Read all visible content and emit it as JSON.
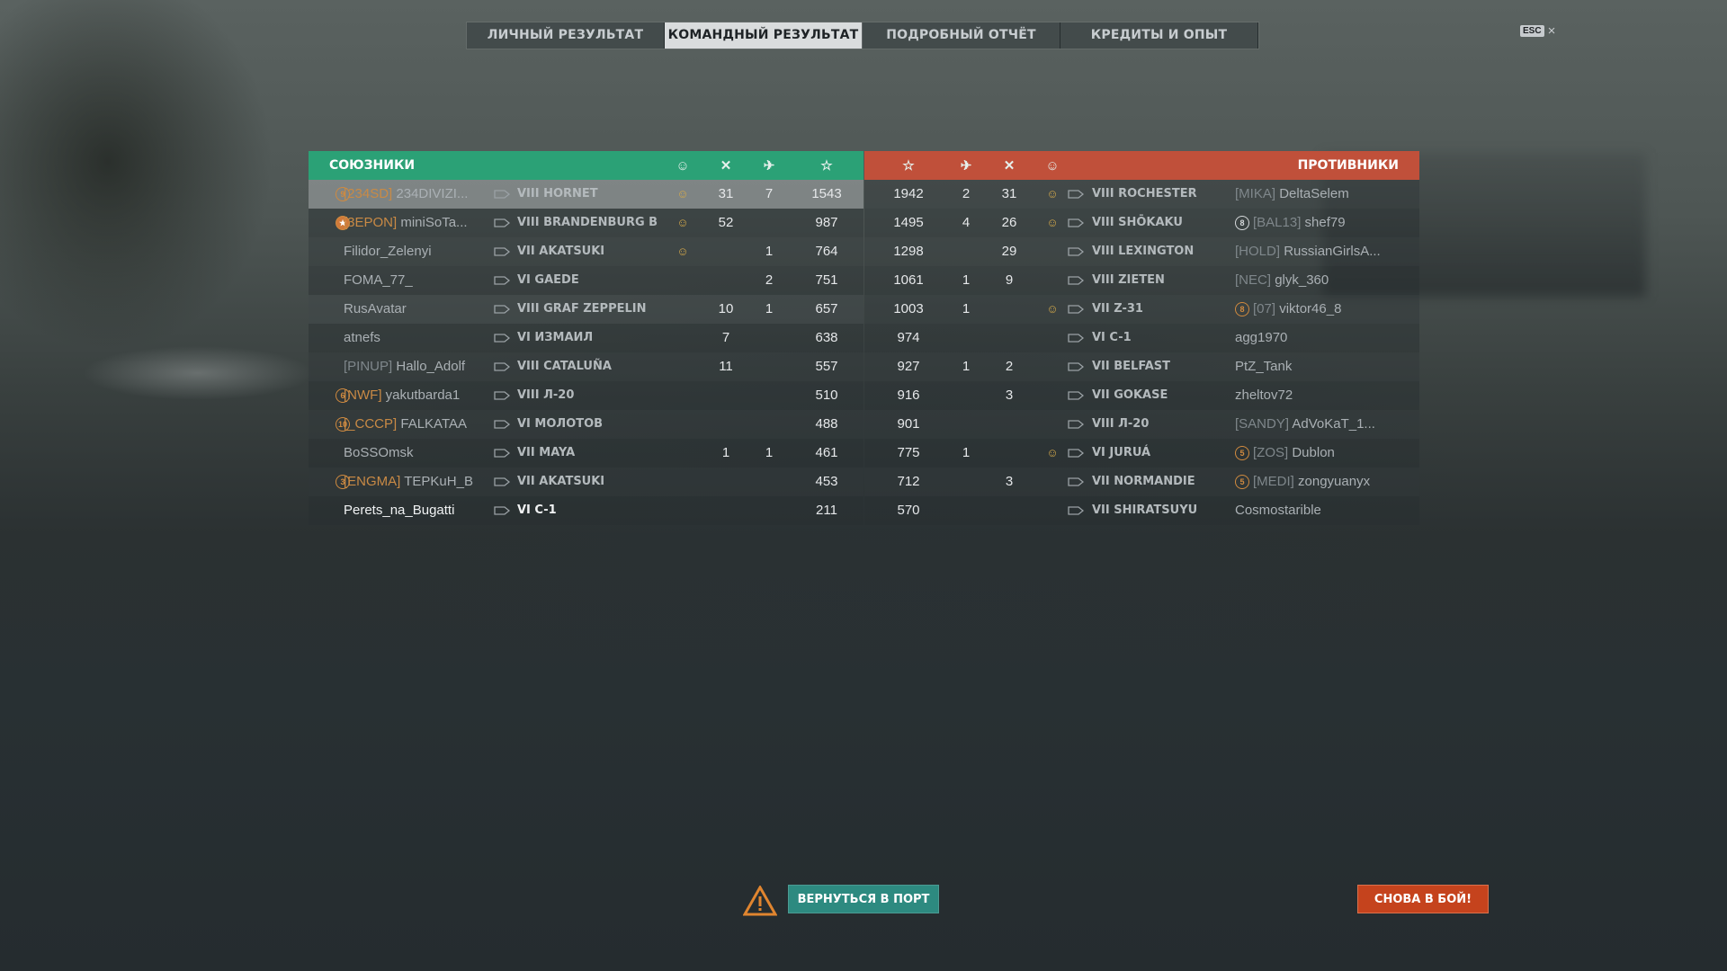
{
  "tabs": [
    "ЛИЧНЫЙ РЕЗУЛЬТАТ",
    "КОМАНДНЫЙ РЕЗУЛЬТАТ",
    "ПОДРОБНЫЙ ОТЧЁТ",
    "КРЕДИТЫ И ОПЫТ"
  ],
  "active_tab": 1,
  "esc_label": "ESC",
  "allies": {
    "title": "СОЮЗНИКИ",
    "header_icons": [
      "capture-icon",
      "kills-icon",
      "planes-icon",
      "experience-icon"
    ],
    "rows": [
      {
        "rank": "9",
        "rank_style": "orange",
        "clan": "[234SD]",
        "player": "234DIVIZI...",
        "ship": "VIII HORNET",
        "medal": true,
        "kills": "31",
        "planes": "7",
        "exp": "1543",
        "state": "highlight"
      },
      {
        "rank": "★",
        "rank_style": "star",
        "clan": "[3EPON]",
        "player": "miniSoTa...",
        "ship": "VIII BRANDENBURG B",
        "medal": true,
        "kills": "52",
        "planes": "",
        "exp": "987",
        "state": ""
      },
      {
        "rank": "",
        "rank_style": "",
        "clan": "",
        "player": "Filidor_Zelenyi",
        "ship": "VII AKATSUKI",
        "medal": true,
        "kills": "",
        "planes": "1",
        "exp": "764",
        "state": ""
      },
      {
        "rank": "",
        "rank_style": "",
        "clan": "",
        "player": "FOMA_77_",
        "ship": "VI GAEDE",
        "medal": false,
        "kills": "",
        "planes": "2",
        "exp": "751",
        "state": ""
      },
      {
        "rank": "",
        "rank_style": "",
        "clan": "",
        "player": "RusAvatar",
        "ship": "VIII GRAF ZEPPELIN",
        "medal": false,
        "kills": "10",
        "planes": "1",
        "exp": "657",
        "state": "me"
      },
      {
        "rank": "",
        "rank_style": "",
        "clan": "",
        "player": "atnefs",
        "ship": "VI ИЗМАИЛ",
        "medal": false,
        "kills": "7",
        "planes": "",
        "exp": "638",
        "state": ""
      },
      {
        "rank": "",
        "rank_style": "",
        "clan": "[PINUP]",
        "player": "Hallo_Adolf",
        "ship": "VIII CATALUÑA",
        "medal": false,
        "kills": "11",
        "planes": "",
        "exp": "557",
        "state": ""
      },
      {
        "rank": "6",
        "rank_style": "orange",
        "clan": "[NWF]",
        "player": "yakutbarda1",
        "ship": "VIII Л-20",
        "medal": false,
        "kills": "",
        "planes": "",
        "exp": "510",
        "state": ""
      },
      {
        "rank": "10",
        "rank_style": "orange",
        "clan": "[_CCCP]",
        "player": "FALKATAA",
        "ship": "VI МОЛОТОВ",
        "medal": false,
        "kills": "",
        "planes": "",
        "exp": "488",
        "state": ""
      },
      {
        "rank": "",
        "rank_style": "",
        "clan": "",
        "player": "BoSSOmsk",
        "ship": "VII MAYA",
        "medal": false,
        "kills": "1",
        "planes": "1",
        "exp": "461",
        "state": ""
      },
      {
        "rank": "3",
        "rank_style": "orange",
        "clan": "[ENGMA]",
        "player": "TEPKuH_B",
        "ship": "VII AKATSUKI",
        "medal": false,
        "kills": "",
        "planes": "",
        "exp": "453",
        "state": ""
      },
      {
        "rank": "",
        "rank_style": "",
        "clan": "",
        "player": "Perets_na_Bugatti",
        "ship": "VI C-1",
        "medal": false,
        "kills": "",
        "planes": "",
        "exp": "211",
        "state": "bright"
      }
    ]
  },
  "enemies": {
    "title": "ПРОТИВНИКИ",
    "header_icons": [
      "experience-icon",
      "planes-icon",
      "kills-icon",
      "capture-icon"
    ],
    "rows": [
      {
        "exp": "1942",
        "planes": "2",
        "kills": "31",
        "medal": true,
        "ship": "VIII ROCHESTER",
        "rank": "",
        "rank_style": "",
        "clan": "[MIKA]",
        "player": "DeltaSelem"
      },
      {
        "exp": "1495",
        "planes": "4",
        "kills": "26",
        "medal": true,
        "ship": "VIII SHŌKAKU",
        "rank": "8",
        "rank_style": "white",
        "clan": "[BAL13]",
        "player": "shef79"
      },
      {
        "exp": "1298",
        "planes": "",
        "kills": "29",
        "medal": false,
        "ship": "VIII LEXINGTON",
        "rank": "",
        "rank_style": "",
        "clan": "[HOLD]",
        "player": "RussianGirlsA..."
      },
      {
        "exp": "1061",
        "planes": "1",
        "kills": "9",
        "medal": false,
        "ship": "VIII ZIETEN",
        "rank": "",
        "rank_style": "",
        "clan": "[NEC]",
        "player": "glyk_360"
      },
      {
        "exp": "1003",
        "planes": "1",
        "kills": "",
        "medal": true,
        "ship": "VII Z-31",
        "rank": "8",
        "rank_style": "orange",
        "clan": "[07]",
        "player": "viktor46_8"
      },
      {
        "exp": "974",
        "planes": "",
        "kills": "",
        "medal": false,
        "ship": "VI C-1",
        "rank": "",
        "rank_style": "",
        "clan": "",
        "player": "agg1970"
      },
      {
        "exp": "927",
        "planes": "1",
        "kills": "2",
        "medal": false,
        "ship": "VII BELFAST",
        "rank": "",
        "rank_style": "",
        "clan": "",
        "player": "PtZ_Tank"
      },
      {
        "exp": "916",
        "planes": "",
        "kills": "3",
        "medal": false,
        "ship": "VII GOKASE",
        "rank": "",
        "rank_style": "",
        "clan": "",
        "player": "zheltov72"
      },
      {
        "exp": "901",
        "planes": "",
        "kills": "",
        "medal": false,
        "ship": "VIII Л-20",
        "rank": "",
        "rank_style": "",
        "clan": "[SANDY]",
        "player": "AdVoKaT_1..."
      },
      {
        "exp": "775",
        "planes": "1",
        "kills": "",
        "medal": true,
        "ship": "VI JURUÁ",
        "rank": "5",
        "rank_style": "orange",
        "clan": "[ZOS]",
        "player": "Dublon"
      },
      {
        "exp": "712",
        "planes": "",
        "kills": "3",
        "medal": false,
        "ship": "VII NORMANDIE",
        "rank": "5",
        "rank_style": "orange",
        "clan": "[MEDI]",
        "player": "zongyuanyx"
      },
      {
        "exp": "570",
        "planes": "",
        "kills": "",
        "medal": false,
        "ship": "VII SHIRATSUYU",
        "rank": "",
        "rank_style": "",
        "clan": "",
        "player": "Cosmostarible"
      }
    ]
  },
  "buttons": {
    "port": "ВЕРНУТЬСЯ В ПОРТ",
    "battle": "СНОВА В БОЙ!"
  },
  "colors": {
    "allies": "#2ba176",
    "enemies": "#c0503a",
    "port": "#2d8a80",
    "battle": "#c5431d"
  }
}
